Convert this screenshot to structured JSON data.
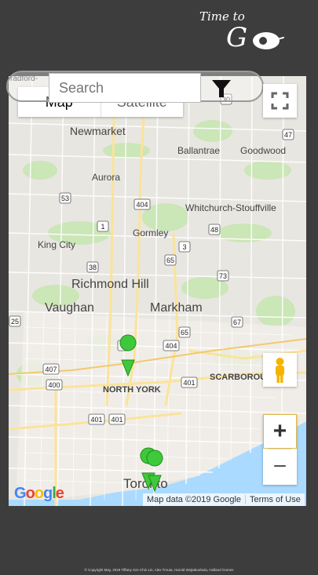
{
  "logo": {
    "line1": "Time to",
    "line2": "G"
  },
  "search": {
    "placeholder": "Search"
  },
  "filter": {
    "icon": "filter-icon"
  },
  "map": {
    "type_options": [
      "Map",
      "Satellite"
    ],
    "labels": {
      "newmarket": "Newmarket",
      "ballantrae": "Ballantrae",
      "goodwood": "Goodwood",
      "aurora": "Aurora",
      "whitchurch": "Whitchurch-Stouffville",
      "king_city": "King City",
      "gormley": "Gormley",
      "richmond_hill": "Richmond Hill",
      "vaughan": "Vaughan",
      "markham": "Markham",
      "north_york": "NORTH YORK",
      "scarborough": "SCARBOROU",
      "toronto": "Toronto",
      "top_left": "radford-"
    },
    "route_shields": [
      "30",
      "47",
      "53",
      "404",
      "1",
      "48",
      "3",
      "65",
      "38",
      "73",
      "25",
      "65",
      "67",
      "1",
      "404",
      "407",
      "400",
      "401",
      "401",
      "401"
    ],
    "zoom_in": "+",
    "zoom_out": "−",
    "google": "Google",
    "attribution": "Map data ©2019 Google",
    "terms": "Terms of Use",
    "markers_color": "#3ec93a"
  },
  "footer": {
    "copyright": "© Copyright May, 2019 Tiffany Sze Chin Lin, Alex Trouta, Harold Wojtaboebula, Holland Gomes"
  }
}
